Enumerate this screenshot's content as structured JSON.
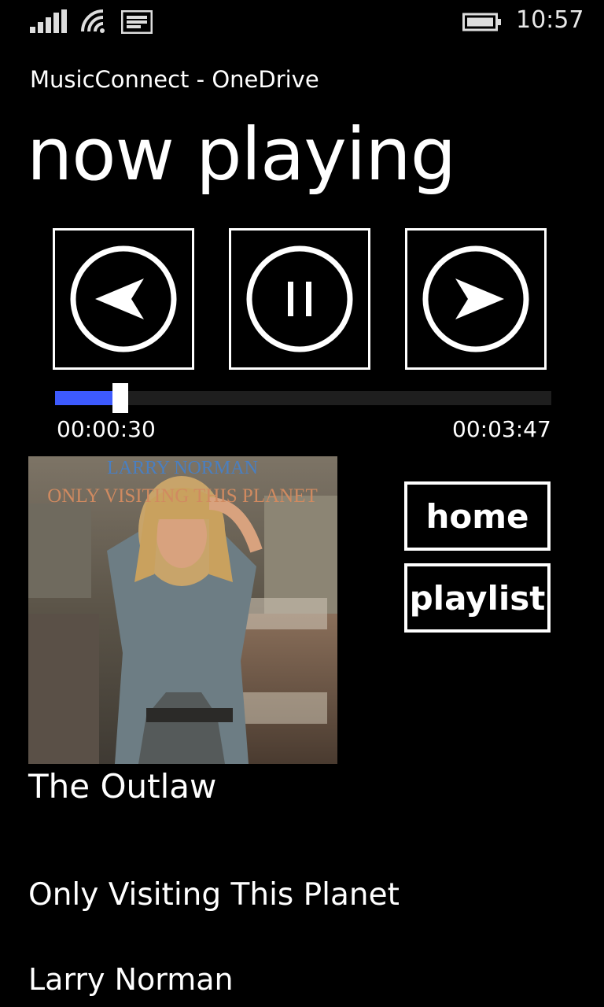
{
  "status_bar": {
    "time": "10:57",
    "icons": [
      "signal-icon",
      "wifi-icon",
      "message-icon",
      "battery-icon"
    ]
  },
  "app": {
    "title": "MusicConnect - OneDrive"
  },
  "page": {
    "title": "now playing"
  },
  "controls": {
    "previous_icon": "previous-icon",
    "pause_icon": "pause-icon",
    "next_icon": "next-icon"
  },
  "progress": {
    "elapsed": "00:00:30",
    "duration": "00:03:47",
    "fraction": 0.132,
    "accent": "#3d5afe"
  },
  "album_art": {
    "cover_text_top": "LARRY NORMAN",
    "cover_text_sub": "ONLY VISITING THIS PLANET"
  },
  "nav": {
    "home_label": "home",
    "playlist_label": "playlist"
  },
  "track": {
    "song": "The Outlaw",
    "album": "Only Visiting This Planet",
    "artist": "Larry Norman"
  }
}
